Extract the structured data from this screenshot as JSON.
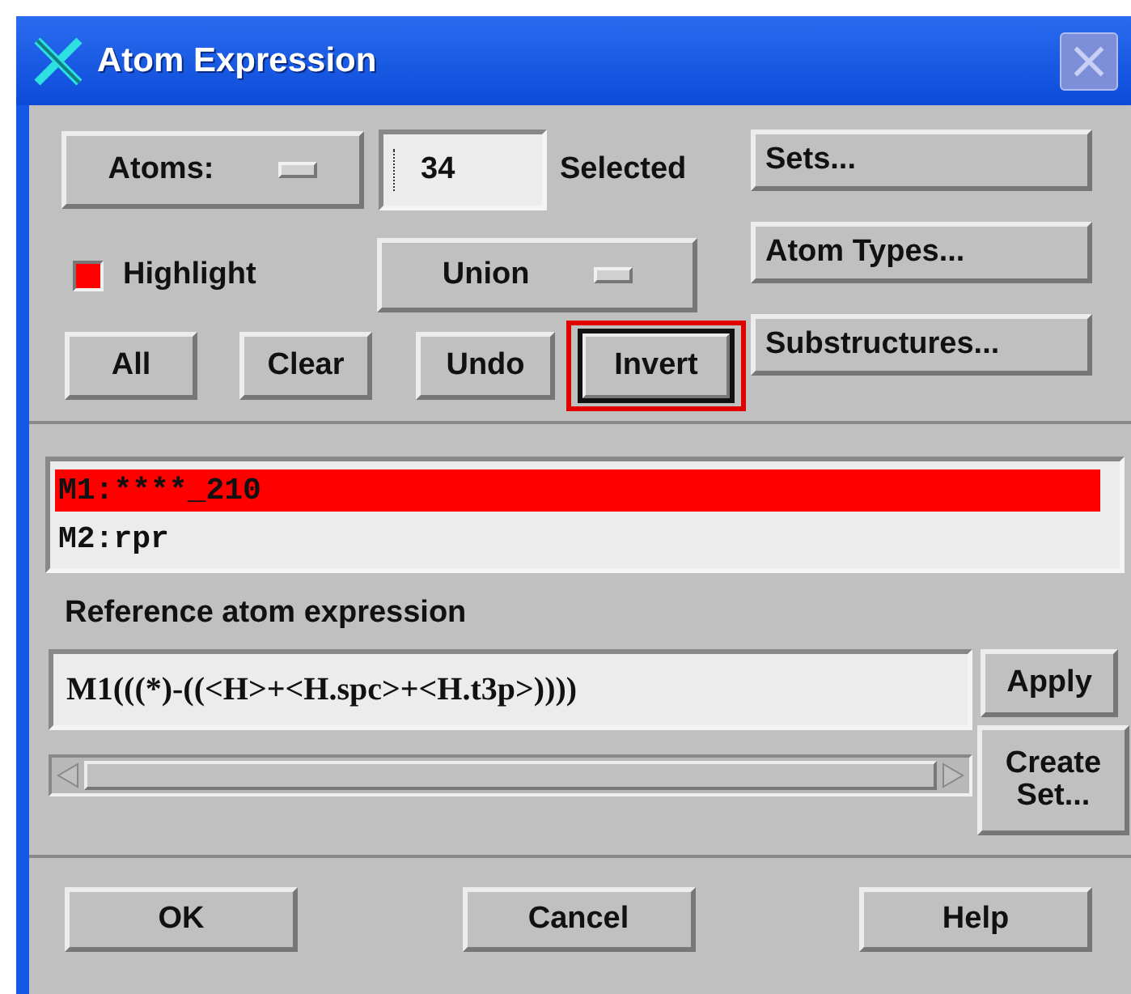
{
  "window": {
    "title": "Atom Expression"
  },
  "atoms_menu": {
    "label": "Atoms:"
  },
  "selected_count": {
    "value": "34",
    "label": "Selected"
  },
  "side_buttons": [
    "Sets...",
    "Atom Types...",
    "Substructures..."
  ],
  "highlight": {
    "label": "Highlight",
    "checked": true
  },
  "mode_menu": {
    "label": "Union"
  },
  "selection_buttons": [
    {
      "label": "All",
      "marked": false,
      "focused": false
    },
    {
      "label": "Clear",
      "marked": false,
      "focused": false
    },
    {
      "label": "Undo",
      "marked": false,
      "focused": false
    },
    {
      "label": "Invert",
      "marked": true,
      "focused": true
    }
  ],
  "molecules": [
    {
      "label": "M1:****_210",
      "selected": true
    },
    {
      "label": "M2:rpr",
      "selected": false
    }
  ],
  "expression": {
    "label": "Reference atom expression",
    "value": "M1(((*)-((<H>+<H.spc>+<H.t3p>))))"
  },
  "expression_buttons": [
    "Apply",
    "Create Set..."
  ],
  "dialog_buttons": [
    "OK",
    "Cancel",
    "Help"
  ]
}
